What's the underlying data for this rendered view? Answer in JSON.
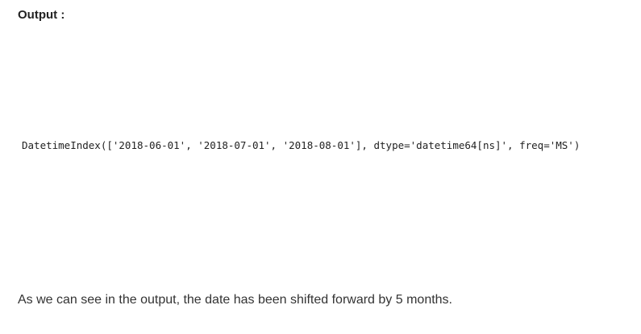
{
  "heading": "Output :",
  "output_text": "DatetimeIndex(['2018-06-01', '2018-07-01', '2018-08-01'], dtype='datetime64[ns]', freq='MS')",
  "paragraph": "As we can see in the output, the date has been shifted forward by 5 months."
}
